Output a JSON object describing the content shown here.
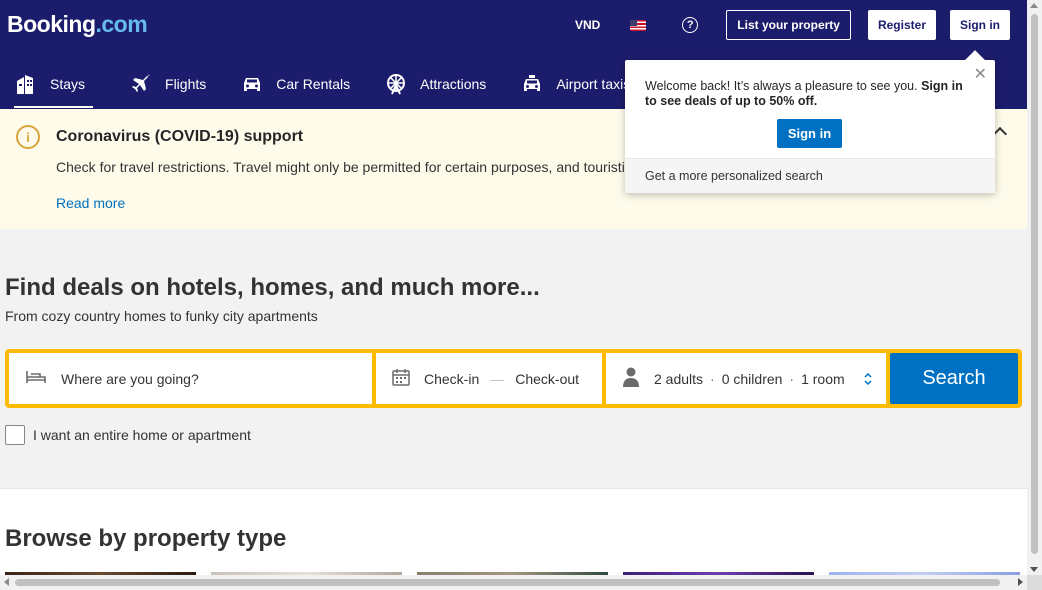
{
  "header": {
    "logo_main": "Booking",
    "logo_dot": ".com",
    "currency": "VND",
    "help_symbol": "?",
    "list_property": "List your property",
    "register": "Register",
    "sign_in": "Sign in"
  },
  "nav": {
    "items": [
      {
        "label": "Stays",
        "icon": "bed-building-icon",
        "active": true
      },
      {
        "label": "Flights",
        "icon": "plane-icon"
      },
      {
        "label": "Car Rentals",
        "icon": "car-icon"
      },
      {
        "label": "Attractions",
        "icon": "ferris-wheel-icon"
      },
      {
        "label": "Airport taxis",
        "icon": "taxi-icon"
      }
    ]
  },
  "covid": {
    "title": "Coronavirus (COVID-19) support",
    "text": "Check for travel restrictions. Travel might only be permitted for certain purposes, and touristic travel in particular may not be allowed.",
    "link": "Read more"
  },
  "hero": {
    "title": "Find deals on hotels, homes, and much more...",
    "subtitle": "From cozy country homes to funky city apartments"
  },
  "search": {
    "destination_placeholder": "Where are you going?",
    "check_in": "Check-in",
    "check_out": "Check-out",
    "dash": "—",
    "adults": "2 adults",
    "children": "0 children",
    "rooms": "1 room",
    "separator": "·",
    "button": "Search",
    "entire_home": "I want an entire home or apartment"
  },
  "browse": {
    "title": "Browse by property type"
  },
  "popup": {
    "message_plain": "Welcome back! It’s always a pleasure to see you. ",
    "message_bold": "Sign in to see deals of up to 50% off.",
    "sign_in": "Sign in",
    "footer": "Get a more personalized search",
    "close_symbol": "✕"
  },
  "colors": {
    "header_bg": "#1c1c6c",
    "search_border": "#febb02",
    "primary_blue": "#0071c2",
    "covid_bg": "#fefbeb"
  }
}
